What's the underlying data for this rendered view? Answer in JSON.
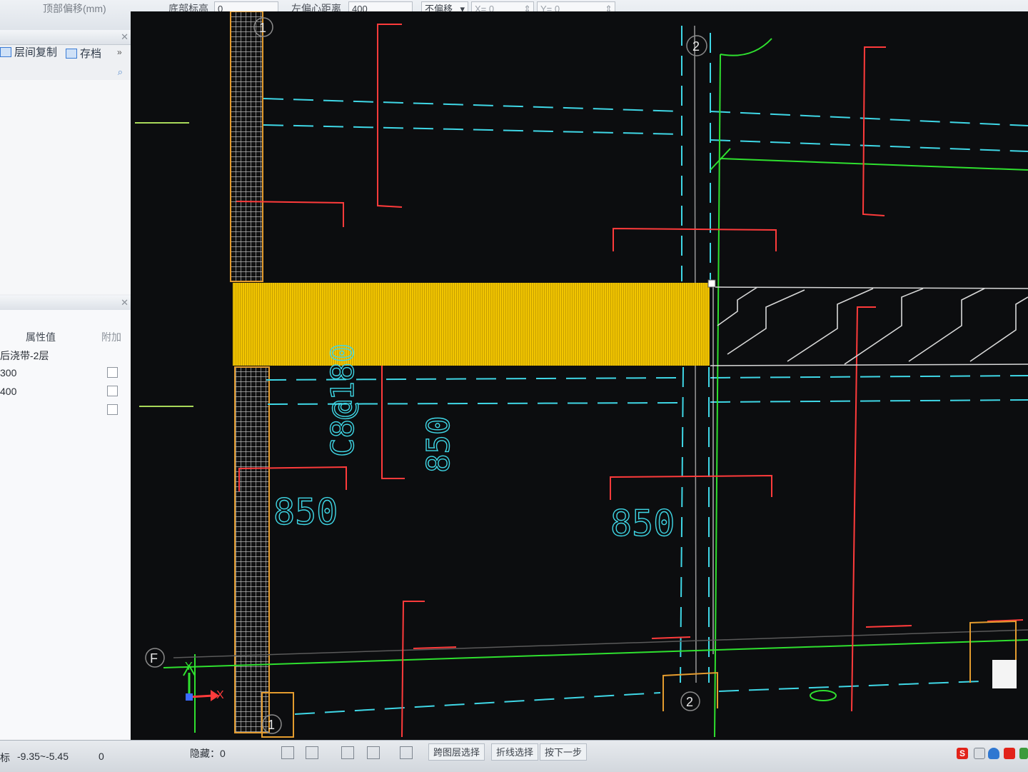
{
  "toolbar": {
    "field1_label": "顶部偏移(mm)",
    "field2_label": "底部标高",
    "field2_value": "0",
    "offset_label": "左偏心距离",
    "offset_value": "400",
    "offset_mode": "不偏移",
    "offset_x_label": "X= 0",
    "offset_y_label": "Y= 0",
    "unit": "mm"
  },
  "left_panel": {
    "copy_floor_label": "层间复制",
    "save_label": "存档",
    "more_label": "»",
    "search_icon": "search-icon",
    "properties": {
      "header_value": "属性值",
      "header_extra": "附加",
      "rows": [
        {
          "value": "后浇带-2层"
        },
        {
          "value": "300"
        },
        {
          "value": "400"
        }
      ]
    }
  },
  "drawing": {
    "axis_labels": {
      "col1_top": "1",
      "col2_top": "2",
      "row_f": "F",
      "col1_bottom": "1",
      "col2_bottom": "2"
    },
    "rebar_label": "C8@180",
    "dim_labels": [
      "850",
      "850",
      "850"
    ],
    "ucs_x": "X",
    "ucs_y": "Y",
    "colors": {
      "background": "#0c0d0f",
      "selection_fill": "#f2c500",
      "dash_line": "#3fd7e6",
      "dimension_red": "#ff3b3b",
      "axis_green": "#2fe02f",
      "column_orange": "#e39b2e",
      "hatch": "#d8d8d8"
    }
  },
  "status": {
    "coord_prefix": "标",
    "coordinates": "-9.35~-5.45",
    "angle": "0",
    "hidden_label": "隐藏：0",
    "cross_layer_select": "跨图层选择",
    "polyline_select": "折线选择",
    "next_item": "按下一步",
    "tray_s_label": "S"
  }
}
